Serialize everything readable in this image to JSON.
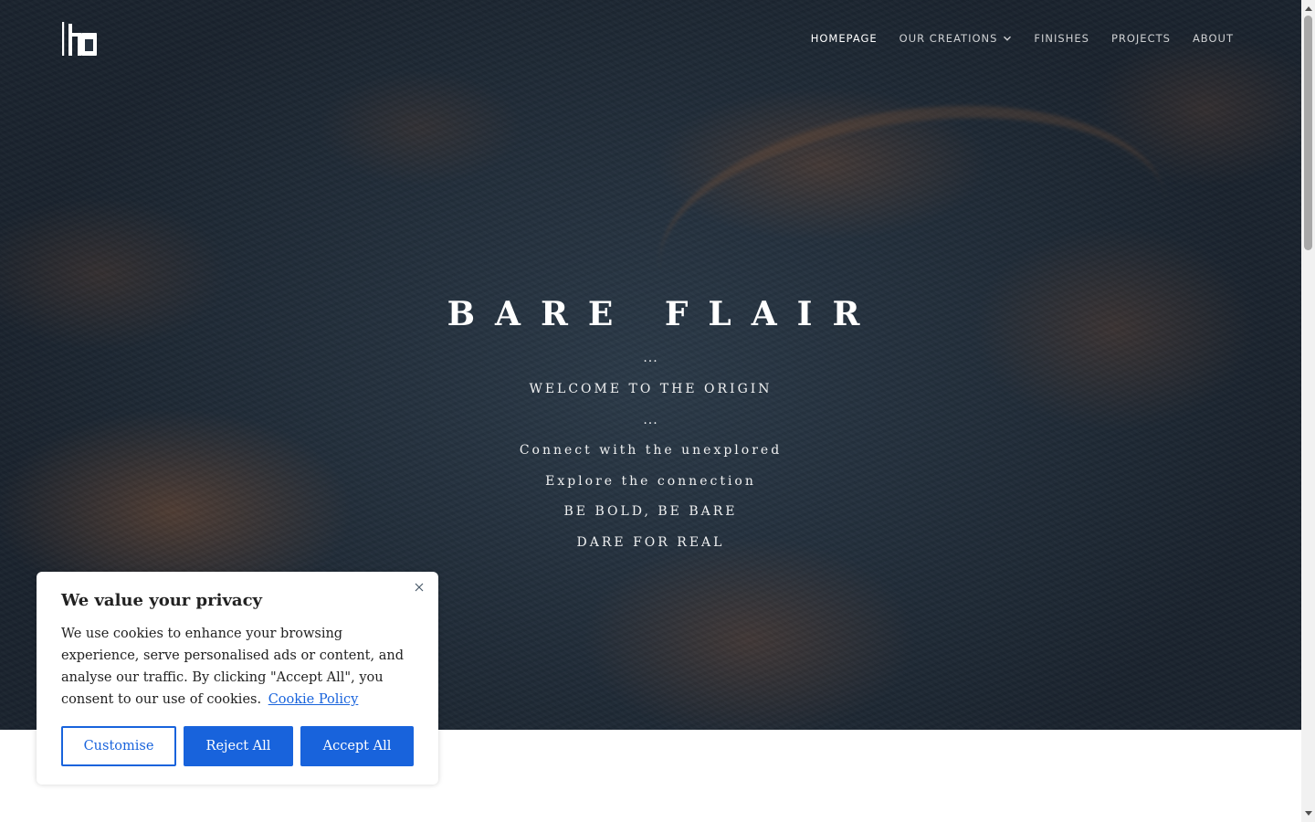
{
  "header": {
    "logo": {
      "icon": "bare-flair-hb-logo",
      "text": "BARE FLAIR"
    },
    "nav": [
      {
        "label": "HOMEPAGE",
        "active": true
      },
      {
        "label": "OUR CREATIONS",
        "has_dropdown": true,
        "icon": "chevron-down-icon"
      },
      {
        "label": "FINISHES"
      },
      {
        "label": "PROJECTS"
      },
      {
        "label": "ABOUT"
      }
    ]
  },
  "hero": {
    "title": "BARE FLAIR",
    "ellipsis_1": "...",
    "tagline": "WELCOME TO THE ORIGIN",
    "ellipsis_2": "...",
    "lines": [
      "Connect with the unexplored",
      "Explore the connection",
      "BE BOLD, BE BARE",
      "DARE FOR REAL"
    ]
  },
  "cookie_banner": {
    "title": "We value your privacy",
    "body": "We use cookies to enhance your browsing experience, serve personalised ads or content, and analyse our traffic. By clicking \"Accept All\", you consent to our use of cookies.",
    "link_text": "Cookie Policy",
    "close_icon": "close-icon",
    "buttons": {
      "customise": "Customise",
      "reject": "Reject All",
      "accept": "Accept All"
    }
  },
  "colors": {
    "accent": "#1863dc",
    "hero_base": "#1f2a36",
    "nav_text": "#ffffff"
  }
}
